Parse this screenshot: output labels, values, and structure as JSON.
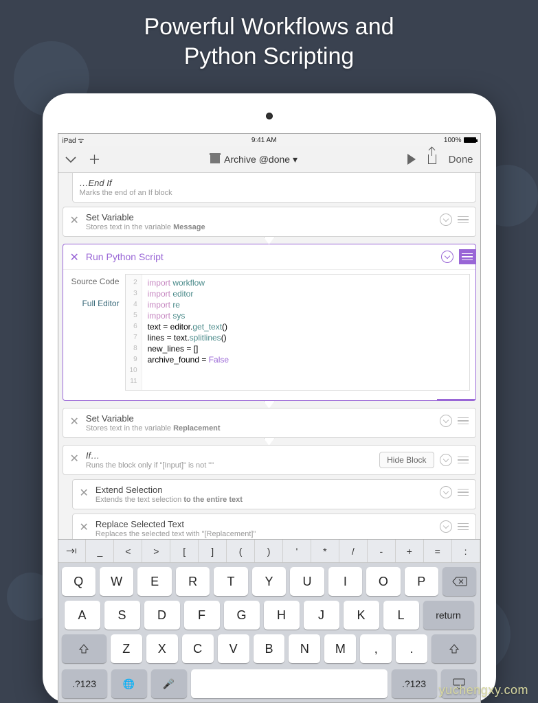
{
  "marketing": {
    "line1": "Powerful Workflows and",
    "line2": "Python Scripting"
  },
  "statusBar": {
    "device": "iPad",
    "time": "9:41 AM",
    "battery": "100%"
  },
  "toolbar": {
    "title": "Archive @done ▾",
    "done": "Done"
  },
  "blocks": {
    "endif": {
      "title": "…End If",
      "desc_pre": "Marks the end of an If block"
    },
    "setVar1": {
      "title": "Set Variable",
      "desc_pre": "Stores text in the variable ",
      "desc_bold": "Message"
    },
    "python": {
      "title": "Run Python Script",
      "sidebarLabel": "Source Code",
      "sidebarLink": "Full Editor"
    },
    "setVar2": {
      "title": "Set Variable",
      "desc_pre": "Stores text in the variable ",
      "desc_bold": "Replacement"
    },
    "ifBlock": {
      "title": "If…",
      "desc": "Runs the block only if \"[Input]\" is not \"\"",
      "hideBtn": "Hide Block"
    },
    "extend": {
      "title": "Extend Selection",
      "desc_pre": "Extends the text selection ",
      "desc_bold": "to the entire text"
    },
    "replace": {
      "title": "Replace Selected Text",
      "desc": "Replaces the selected text with \"[Replacement]\""
    }
  },
  "code": {
    "lineNumbers": [
      "2",
      "3",
      "4",
      "5",
      "6",
      "7",
      "8",
      "9",
      "10",
      "11"
    ],
    "lines": [
      {
        "t": [
          [
            "kw",
            "import"
          ],
          [
            "",
            ""
          ],
          [
            "mod",
            "workflow"
          ]
        ]
      },
      {
        "t": [
          [
            "kw",
            "import"
          ],
          [
            "",
            ""
          ],
          [
            "mod",
            "editor"
          ]
        ]
      },
      {
        "t": [
          [
            "kw",
            "import"
          ],
          [
            "",
            ""
          ],
          [
            "mod",
            "re"
          ]
        ]
      },
      {
        "t": [
          [
            "kw",
            "import"
          ],
          [
            "",
            ""
          ],
          [
            "mod",
            "sys"
          ]
        ]
      },
      {
        "t": [
          [
            "",
            ""
          ]
        ]
      },
      {
        "t": [
          [
            "",
            "text = editor."
          ],
          [
            "fn",
            "get_text"
          ],
          [
            "",
            "()"
          ]
        ]
      },
      {
        "t": [
          [
            "",
            "lines = text."
          ],
          [
            "fn",
            "splitlines"
          ],
          [
            "",
            "()"
          ]
        ]
      },
      {
        "t": [
          [
            "",
            ""
          ]
        ]
      },
      {
        "t": [
          [
            "",
            "new_lines = []"
          ]
        ]
      },
      {
        "t": [
          [
            "",
            "archive_found = "
          ],
          [
            "const",
            "False"
          ]
        ]
      }
    ]
  },
  "accessory": [
    "_",
    "<",
    ">",
    "[",
    "]",
    "(",
    ")",
    "'",
    "*",
    "/",
    "-",
    "+",
    "=",
    ":"
  ],
  "kbRow1": [
    "Q",
    "W",
    "E",
    "R",
    "T",
    "Y",
    "U",
    "I",
    "O",
    "P"
  ],
  "kbRow2": [
    "A",
    "S",
    "D",
    "F",
    "G",
    "H",
    "J",
    "K",
    "L"
  ],
  "kbRow3": [
    "Z",
    "X",
    "C",
    "V",
    "B",
    "N",
    "M"
  ],
  "kbReturn": "return",
  "kbNum": ".?123",
  "watermark": "yuchengxy.com"
}
